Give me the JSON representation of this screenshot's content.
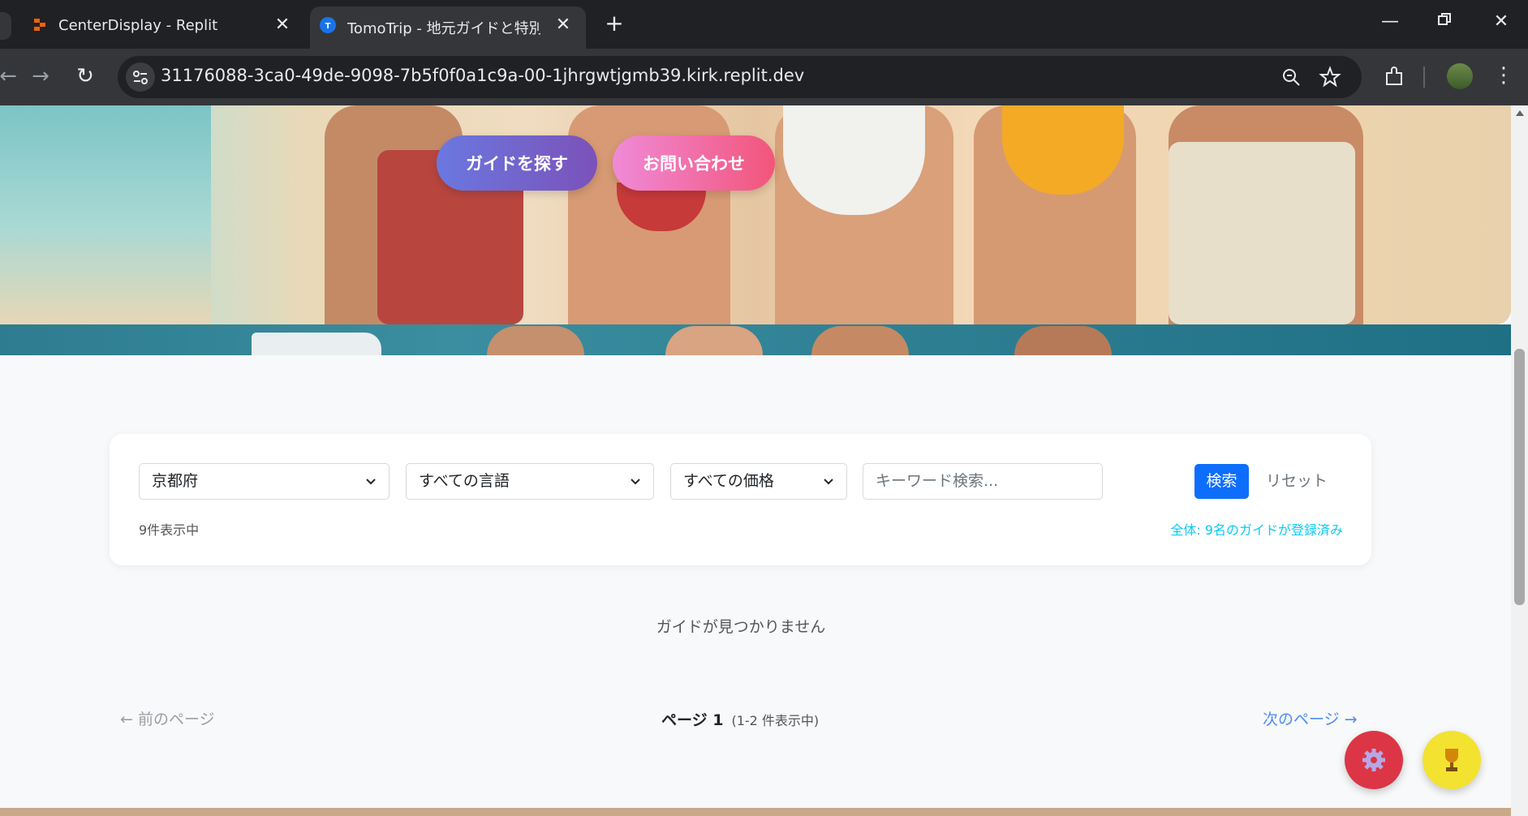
{
  "browser": {
    "tabs": [
      {
        "title": "CenterDisplay - Replit",
        "favicon": "replit-icon",
        "active": false
      },
      {
        "title": "TomoTrip - 地元ガイドと特別な旅",
        "favicon": "tomotrip-icon",
        "active": true
      }
    ],
    "url": "31176088-3ca0-49de-9098-7b5f0f0a1c9a-00-1jhrgwtjgmb39.kirk.replit.dev"
  },
  "hero": {
    "find_guide_label": "ガイドを探す",
    "contact_label": "お問い合わせ"
  },
  "filters": {
    "region": "京都府",
    "language": "すべての言語",
    "price": "すべての価格",
    "keyword_placeholder": "キーワード検索...",
    "search_label": "検索",
    "reset_label": "リセット",
    "result_count": "9件表示中",
    "total_text": "全体: 9名のガイドが登録済み"
  },
  "results": {
    "empty_message": "ガイドが見つかりません"
  },
  "pagination": {
    "prev_label": "← 前のページ",
    "page_label": "ページ 1",
    "range_label": "(1-2 件表示中)",
    "next_label": "次のページ →"
  },
  "fabs": {
    "settings_icon": "gear-icon",
    "trophy_icon": "trophy-icon"
  },
  "colors": {
    "primary": "#0d6efd",
    "info": "#0dcaf0",
    "danger": "#dc3545",
    "warning": "#f3e22f"
  }
}
